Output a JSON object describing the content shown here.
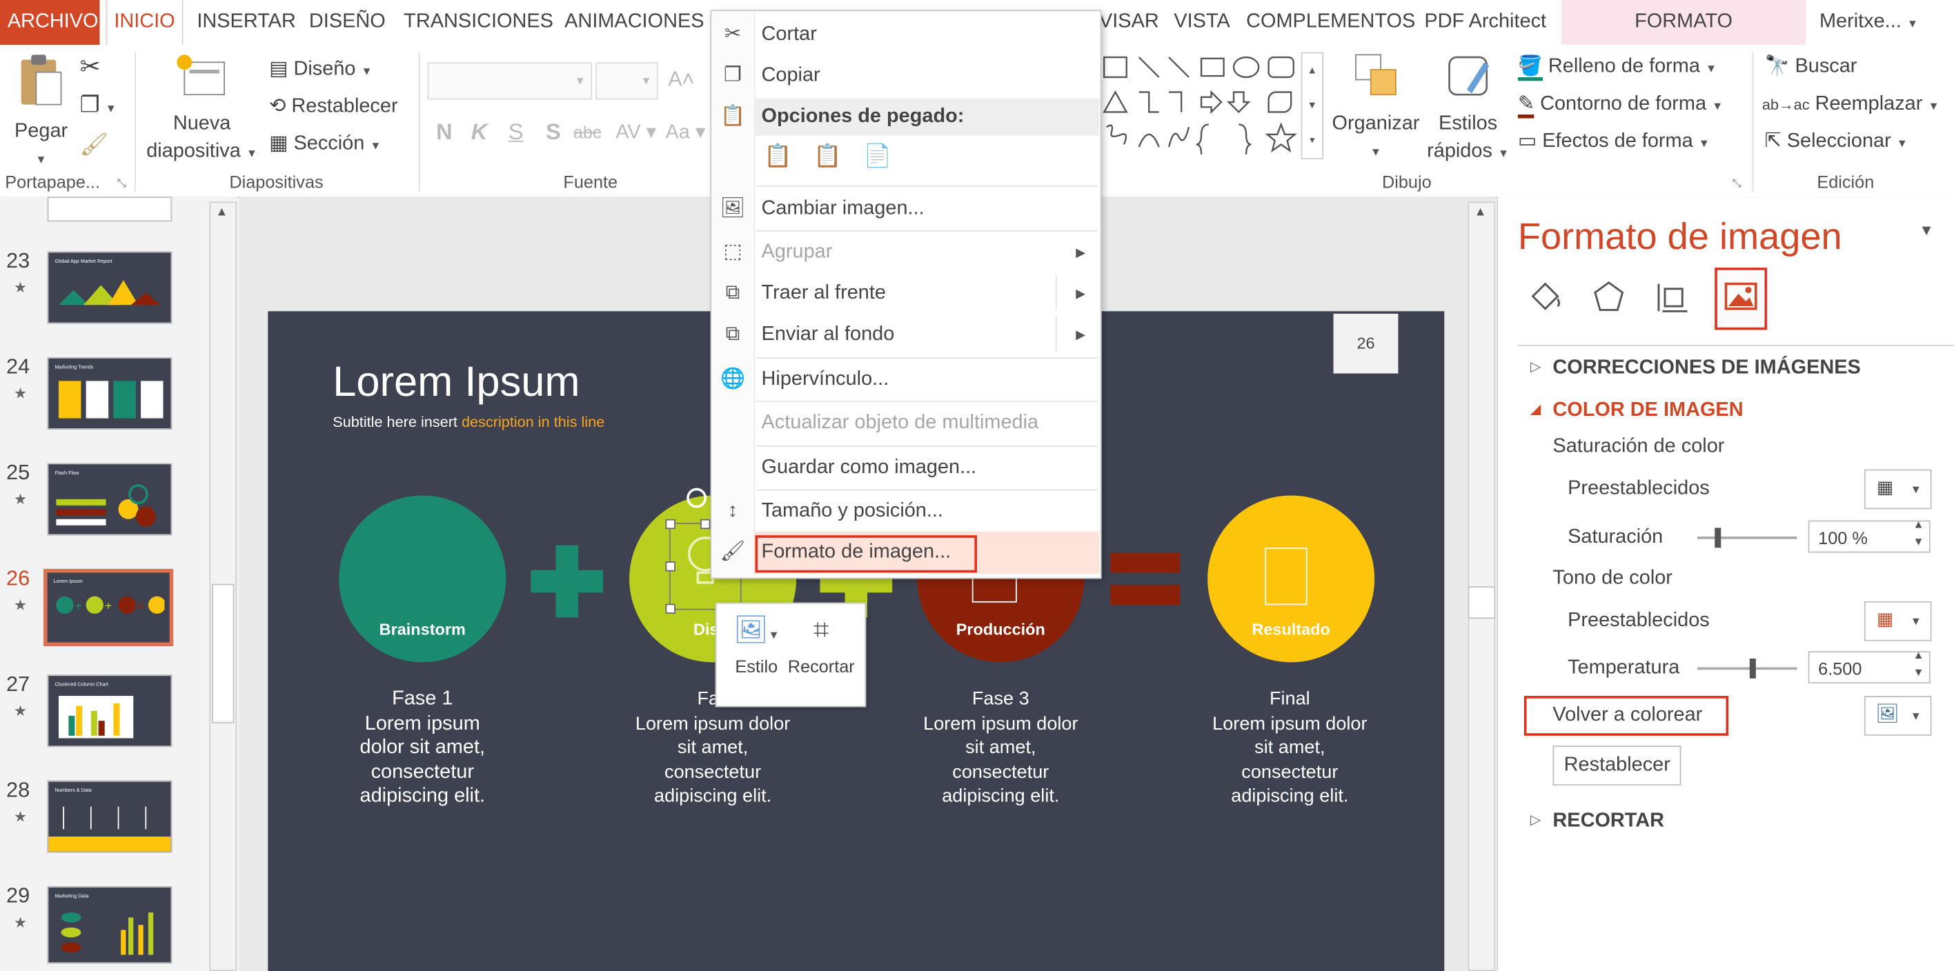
{
  "tabs": [
    "ARCHIVO",
    "INICIO",
    "INSERTAR",
    "DISEÑO",
    "TRANSICIONES",
    "ANIMACIONES",
    "VISAR",
    "VISTA",
    "COMPLEMENTOS",
    "PDF Architect"
  ],
  "context_tab": "FORMATO",
  "user": "Meritxe...",
  "ribbon": {
    "portapapeles": {
      "pegar": "Pegar",
      "label": "Portapape..."
    },
    "diapositivas": {
      "nueva_line1": "Nueva",
      "nueva_line2": "diapositiva",
      "diseno": "Diseño",
      "restablecer": "Restablecer",
      "seccion": "Sección",
      "label": "Diapositivas"
    },
    "fuente": {
      "label": "Fuente"
    },
    "dibujo": {
      "organizar": "Organizar",
      "estilos_line1": "Estilos",
      "estilos_line2": "rápidos",
      "relleno": "Relleno de forma",
      "contorno": "Contorno de forma",
      "efectos": "Efectos de forma",
      "label": "Dibujo"
    },
    "edicion": {
      "buscar": "Buscar",
      "reemplazar": "Reemplazar",
      "seleccionar": "Seleccionar",
      "label": "Edición"
    }
  },
  "thumbnails": [
    {
      "num": "23",
      "title": "Global App Market Report"
    },
    {
      "num": "24",
      "title": "Marketing Trends"
    },
    {
      "num": "25",
      "title": "Flash Flow"
    },
    {
      "num": "26",
      "title": "Lorem Ipsum"
    },
    {
      "num": "27",
      "title": "Clustered Column Chart"
    },
    {
      "num": "28",
      "title": "Numbers & Data"
    },
    {
      "num": "29",
      "title": "Marketing Data"
    }
  ],
  "slide": {
    "number": "26",
    "title": "Lorem Ipsum",
    "subtitle_a": "Subtitle here insert ",
    "subtitle_b": "description in this line",
    "circles": [
      "Brainstorm",
      "Dis...",
      "Producción",
      "Resultado"
    ],
    "phases": [
      {
        "title": "Fase 1",
        "body": "Lorem ipsum dolor sit amet, consectetur adipiscing elit."
      },
      {
        "title": "Fas",
        "body": "Lorem ipsum dolor sit amet, consectetur adipiscing elit."
      },
      {
        "title": "Fase 3",
        "body": "Lorem ipsum dolor sit amet, consectetur adipiscing elit."
      },
      {
        "title": "Final",
        "body": "Lorem ipsum dolor sit amet, consectetur adipiscing elit."
      }
    ],
    "colors": {
      "bg": "#3d4150",
      "green": "#1b8b70",
      "lime": "#b9cf1f",
      "red": "#8b2009",
      "yellow": "#fcc40a",
      "accent": "#f5a623"
    }
  },
  "context_menu": {
    "cortar": "Cortar",
    "copiar": "Copiar",
    "opciones_pegado": "Opciones de pegado:",
    "cambiar_imagen": "Cambiar imagen...",
    "agrupar": "Agrupar",
    "traer_frente": "Traer al frente",
    "enviar_fondo": "Enviar al fondo",
    "hipervinculo": "Hipervínculo...",
    "actualizar": "Actualizar objeto de multimedia",
    "guardar": "Guardar como imagen...",
    "tamano": "Tamaño y posición...",
    "formato": "Formato de imagen..."
  },
  "mini_toolbar": {
    "estilo": "Estilo",
    "recortar": "Recortar"
  },
  "pane": {
    "title": "Formato de imagen",
    "correcciones": "CORRECCIONES DE IMÁGENES",
    "color": "COLOR DE IMAGEN",
    "saturacion_color": "Saturación de color",
    "preestablecidos": "Preestablecidos",
    "saturacion": "Saturación",
    "saturacion_val": "100 %",
    "saturacion_level": 0.18,
    "tono": "Tono de color",
    "temperatura": "Temperatura",
    "temperatura_val": "6.500",
    "temperatura_level": 0.52,
    "volver": "Volver a colorear",
    "restablecer": "Restablecer",
    "recortar": "RECORTAR",
    "accent": "#d24726",
    "highlight": "#e0301e"
  }
}
